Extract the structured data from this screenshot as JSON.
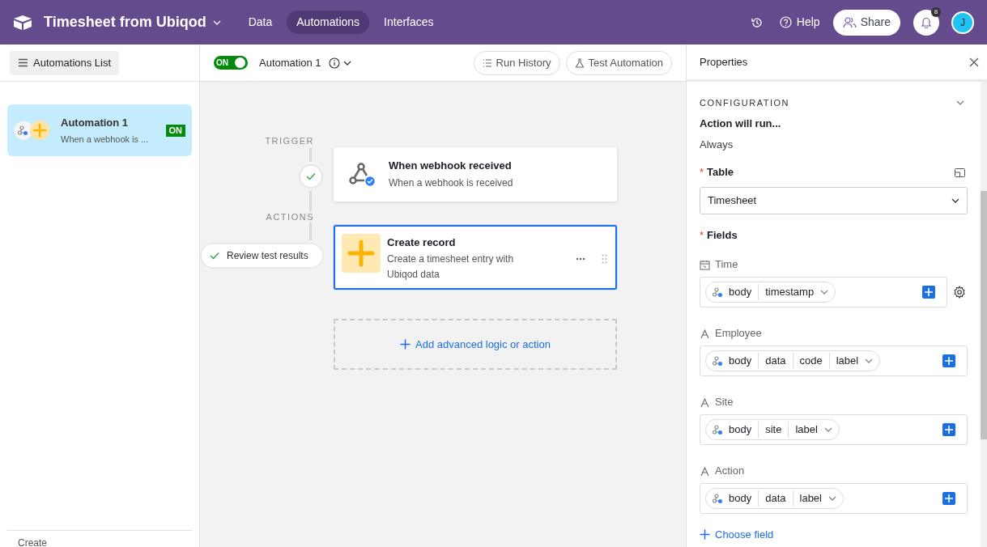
{
  "app": {
    "title": "Timesheet from Ubiqod"
  },
  "nav_tabs": [
    {
      "label": "Data",
      "selected": false
    },
    {
      "label": "Automations",
      "selected": true
    },
    {
      "label": "Interfaces",
      "selected": false
    }
  ],
  "header_actions": {
    "help": "Help",
    "share": "Share",
    "notifications": "8",
    "avatar": "J"
  },
  "sidebar": {
    "toggle": "Automations List",
    "automations": [
      {
        "name": "Automation 1",
        "description": "When a webhook is ...",
        "status": "ON",
        "selected": true
      }
    ],
    "footer": "Create"
  },
  "toolbar": {
    "enabled": true,
    "toggle_label": "ON",
    "name": "Automation 1",
    "buttons": [
      "Run History",
      "Test Automation"
    ]
  },
  "flow": {
    "trigger_label": "TRIGGER",
    "actions_label": "ACTIONS",
    "review": "Review test results",
    "trigger": {
      "title": "When webhook received",
      "description": "When a webhook is received",
      "tested": true
    },
    "actions": [
      {
        "title": "Create record",
        "description": "Create a timesheet entry with Ubiqod data",
        "selected": true
      }
    ],
    "add": "Add advanced logic or action"
  },
  "properties": {
    "title": "Properties",
    "section": "CONFIGURATION",
    "run_label": "Action will run...",
    "run_value": "Always",
    "table": {
      "required_mark": "*",
      "label": "Table",
      "value": "Timesheet"
    },
    "fields_heading": {
      "required_mark": "*",
      "label": "Fields"
    },
    "fields": [
      {
        "name": "Time",
        "kind": "date",
        "tokens": [
          "body",
          "timestamp"
        ],
        "settings": true
      },
      {
        "name": "Employee",
        "kind": "text",
        "tokens": [
          "body",
          "data",
          "code",
          "label"
        ],
        "settings": false
      },
      {
        "name": "Site",
        "kind": "text",
        "tokens": [
          "body",
          "site",
          "label"
        ],
        "settings": false
      },
      {
        "name": "Action",
        "kind": "text",
        "tokens": [
          "body",
          "data",
          "label"
        ],
        "settings": false
      }
    ],
    "choose": "Choose field"
  }
}
